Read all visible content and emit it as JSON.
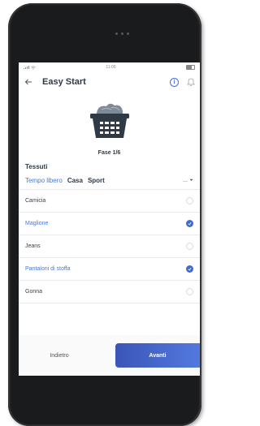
{
  "status_bar": {
    "time": "11:00"
  },
  "header": {
    "title": "Easy Start"
  },
  "phase": {
    "label": "Fase 1/6"
  },
  "section": {
    "title": "Tessuti"
  },
  "tabs": [
    {
      "label": "Tempo libero",
      "active": true
    },
    {
      "label": "Casa",
      "active": false
    },
    {
      "label": "Sport",
      "active": false
    }
  ],
  "tabs_more": {
    "label": "..."
  },
  "items": [
    {
      "label": "Camicia",
      "selected": false
    },
    {
      "label": "Maglione",
      "selected": true
    },
    {
      "label": "Jeans",
      "selected": false
    },
    {
      "label": "Pantaloni di stoffa",
      "selected": true
    },
    {
      "label": "Gonna",
      "selected": false
    }
  ],
  "footer": {
    "back_label": "Indietro",
    "next_label": "Avanti"
  },
  "colors": {
    "accent": "#4a75d8",
    "button_gradient_start": "#3b55b8",
    "button_gradient_end": "#5379de"
  }
}
